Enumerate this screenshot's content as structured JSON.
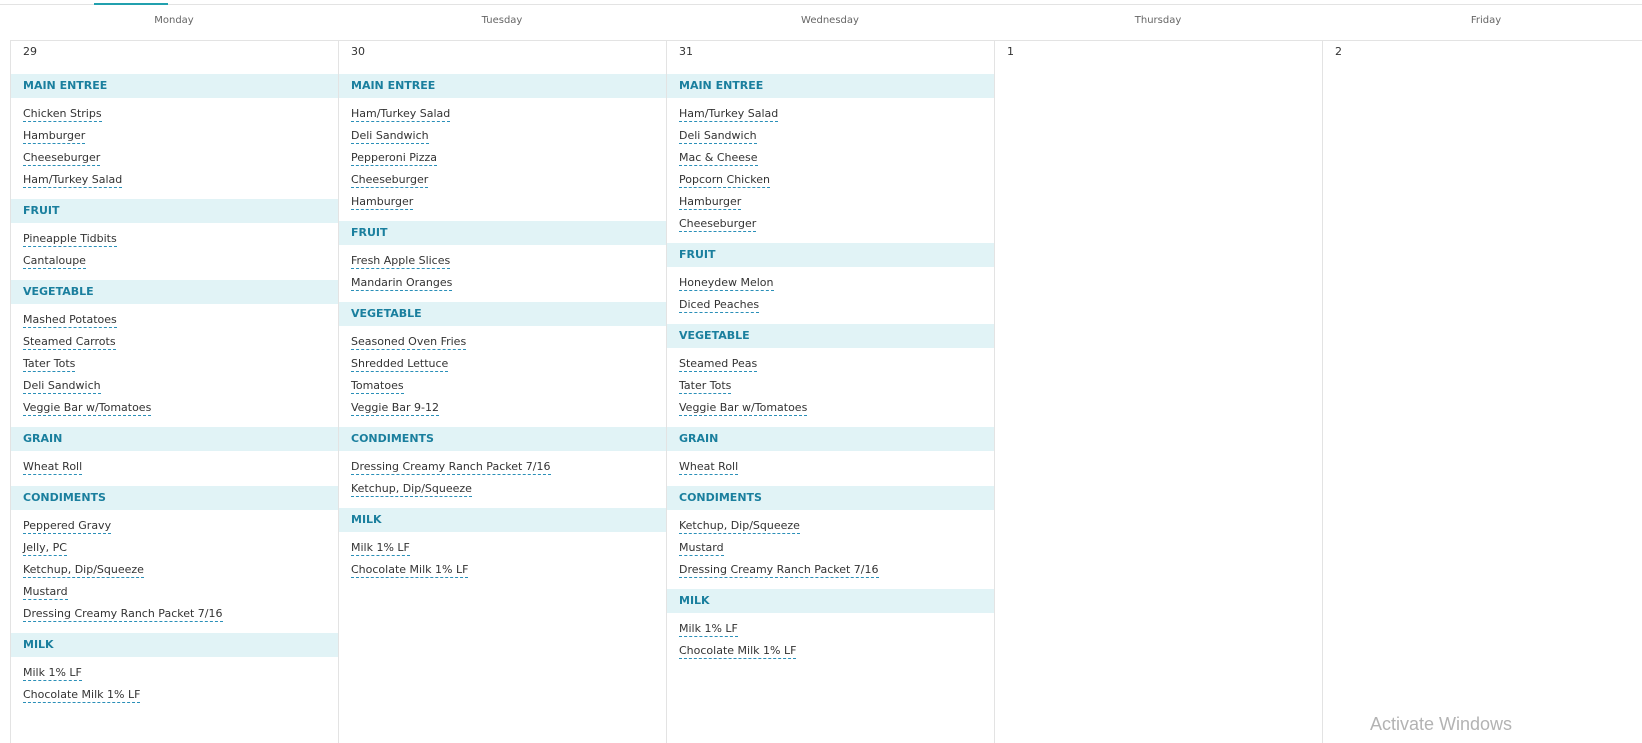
{
  "week": {
    "days": [
      {
        "name": "Monday",
        "date": "29",
        "sections": [
          {
            "category": "MAIN ENTREE",
            "items": [
              "Chicken Strips",
              "Hamburger",
              "Cheeseburger",
              "Ham/Turkey Salad"
            ]
          },
          {
            "category": "FRUIT",
            "items": [
              "Pineapple Tidbits",
              "Cantaloupe"
            ]
          },
          {
            "category": "VEGETABLE",
            "items": [
              "Mashed Potatoes",
              "Steamed Carrots",
              "Tater Tots",
              "Deli Sandwich",
              "Veggie Bar w/Tomatoes"
            ]
          },
          {
            "category": "GRAIN",
            "items": [
              "Wheat Roll"
            ]
          },
          {
            "category": "CONDIMENTS",
            "items": [
              "Peppered Gravy",
              "Jelly, PC",
              "Ketchup, Dip/Squeeze",
              "Mustard",
              "Dressing Creamy Ranch Packet 7/16"
            ]
          },
          {
            "category": "MILK",
            "items": [
              "Milk 1% LF",
              "Chocolate Milk 1% LF"
            ]
          }
        ]
      },
      {
        "name": "Tuesday",
        "date": "30",
        "sections": [
          {
            "category": "MAIN ENTREE",
            "items": [
              "Ham/Turkey Salad",
              "Deli Sandwich",
              "Pepperoni Pizza",
              "Cheeseburger",
              "Hamburger"
            ]
          },
          {
            "category": "FRUIT",
            "items": [
              "Fresh Apple Slices",
              "Mandarin Oranges"
            ]
          },
          {
            "category": "VEGETABLE",
            "items": [
              "Seasoned Oven Fries",
              "Shredded Lettuce",
              "Tomatoes",
              "Veggie Bar 9-12"
            ]
          },
          {
            "category": "CONDIMENTS",
            "items": [
              "Dressing Creamy Ranch Packet 7/16",
              "Ketchup, Dip/Squeeze"
            ]
          },
          {
            "category": "MILK",
            "items": [
              "Milk 1% LF",
              "Chocolate Milk 1% LF"
            ]
          }
        ]
      },
      {
        "name": "Wednesday",
        "date": "31",
        "sections": [
          {
            "category": "MAIN ENTREE",
            "items": [
              "Ham/Turkey Salad",
              "Deli Sandwich",
              "Mac & Cheese",
              "Popcorn Chicken",
              "Hamburger",
              "Cheeseburger"
            ]
          },
          {
            "category": "FRUIT",
            "items": [
              "Honeydew Melon",
              "Diced Peaches"
            ]
          },
          {
            "category": "VEGETABLE",
            "items": [
              "Steamed Peas",
              "Tater Tots",
              "Veggie Bar w/Tomatoes"
            ]
          },
          {
            "category": "GRAIN",
            "items": [
              "Wheat Roll"
            ]
          },
          {
            "category": "CONDIMENTS",
            "items": [
              "Ketchup, Dip/Squeeze",
              "Mustard",
              "Dressing Creamy Ranch Packet 7/16"
            ]
          },
          {
            "category": "MILK",
            "items": [
              "Milk 1% LF",
              "Chocolate Milk 1% LF"
            ]
          }
        ]
      },
      {
        "name": "Thursday",
        "date": "1",
        "sections": []
      },
      {
        "name": "Friday",
        "date": "2",
        "sections": []
      }
    ]
  },
  "watermark": "Activate Windows",
  "colors": {
    "category_bg": "#e1f3f6",
    "category_text": "#1a7f9e",
    "link_underline": "#2a8fb8",
    "tab_indicator": "#21a0ae"
  }
}
